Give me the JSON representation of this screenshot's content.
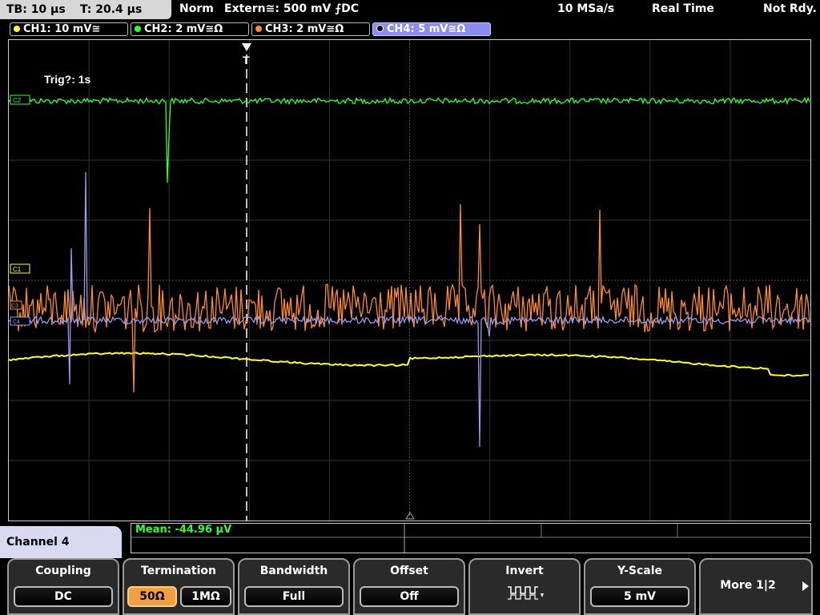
{
  "topbar": {
    "timebase": "TB: 10 µs",
    "trigger_time": "T: 20.4 µs",
    "trigger_mode": "Norm",
    "trigger_source": "Extern≅: 500 mV ⨍DC",
    "sample_rate": "10 MSa/s",
    "acq_mode": "Real Time",
    "status": "Not Rdy."
  },
  "channels": [
    {
      "label": "CH1: 10 mV≅",
      "color": "#ffff33"
    },
    {
      "label": "CH2: 2 mV≅Ω",
      "color": "#33ff33"
    },
    {
      "label": "CH3: 2 mV≅Ω",
      "color": "#ff8c33"
    },
    {
      "label": "CH4: 5 mV≅Ω",
      "color": "#9a9af0"
    }
  ],
  "screen": {
    "trigger_info": "Trig?: 1s",
    "trigger_marker": "T",
    "markers": {
      "ch2": "C2",
      "ch1": "C1",
      "ch3": "C3",
      "ch4": "C4"
    }
  },
  "measurement": {
    "mean": "Mean: -44.96 µV"
  },
  "menu": {
    "title": "Channel 4",
    "coupling": {
      "title": "Coupling",
      "value": "DC"
    },
    "termination": {
      "title": "Termination",
      "opt1": "50Ω",
      "opt2": "1MΩ"
    },
    "bandwidth": {
      "title": "Bandwidth",
      "value": "Full"
    },
    "offset": {
      "title": "Offset",
      "value": "Off"
    },
    "invert": {
      "title": "Invert",
      "icon": "invert-wave-icon"
    },
    "yscale": {
      "title": "Y-Scale",
      "value": "5 mV"
    },
    "more": {
      "title": "More 1|2"
    }
  }
}
